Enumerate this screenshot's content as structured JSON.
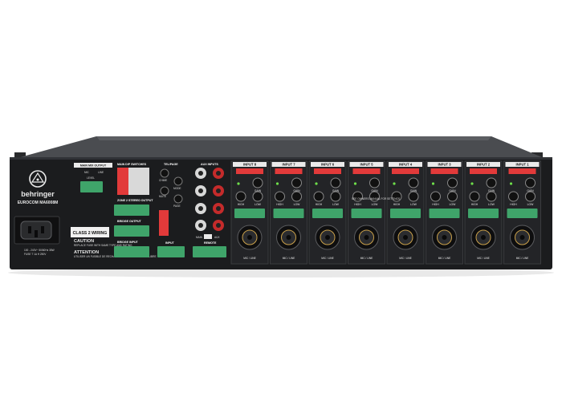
{
  "device": {
    "brand": "behringer",
    "model": "EUROCOM MA6008M",
    "labels": {
      "main_mix_output": "MAIN MIX OUTPUT",
      "mic": "MIC",
      "line": "LINE",
      "level": "LEVEL",
      "main_dip": "MAIN DIP SWITCHES",
      "zone": "ZONE 2 STEREO OUTPUT",
      "bridge_output": "BRIDGE OUTPUT",
      "bridge_input": "BRIDGE INPUT",
      "tel_page": "TEL/PAGE",
      "chime": "CHIME",
      "mode": "MODE",
      "mute": "MUTE",
      "page": "PAGE",
      "input": "INPUT",
      "aux_inputs": "AUX INPUTS",
      "main": "MAIN",
      "aux": "AUX",
      "remote": "REMOTE",
      "class2": "CLASS 2 WIRING",
      "caution": "CAUTION",
      "caution_text": "REPLACE FUSE WITH SAME TYPE AND RATING",
      "attention": "ATTENTION",
      "attention_text": "UTILISER UN FUSIBLE DE RECHANGE DE MEME TYPE ET CALIBRE",
      "power_spec": "100 - 240V~ 50/60Hz 35W",
      "fuse": "FUSE T 1A H 250V",
      "see_manual": "SEE OWNERS MANUAL FOR SETTINGS",
      "gain": "GAIN",
      "high": "HIGH",
      "low": "LOW",
      "mic_line": "MIC / LINE"
    },
    "channels": [
      {
        "label": "INPUT 8"
      },
      {
        "label": "INPUT 7"
      },
      {
        "label": "INPUT 6"
      },
      {
        "label": "INPUT 5"
      },
      {
        "label": "INPUT 4"
      },
      {
        "label": "INPUT 3"
      },
      {
        "label": "INPUT 2"
      },
      {
        "label": "INPUT 1"
      }
    ],
    "colors": {
      "chassis": "#1b1c1e",
      "panel_top": "#46484c",
      "dip_red": "#e23a3a",
      "terminal_green": "#3fa46a",
      "led_green": "#6fe04a",
      "rca_red": "#c52b2b"
    }
  }
}
